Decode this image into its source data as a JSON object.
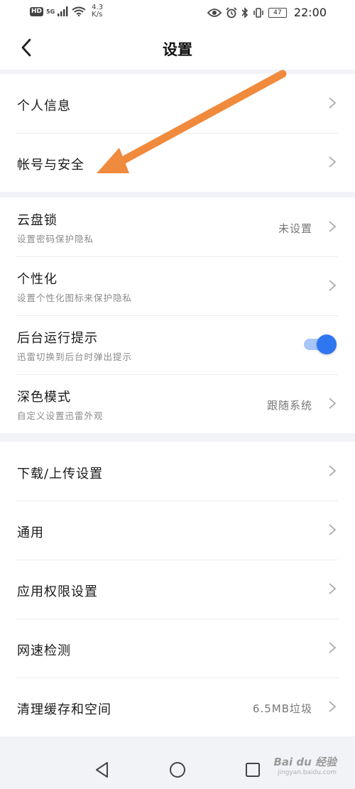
{
  "status_bar": {
    "left_badges": [
      "HD",
      "5G"
    ],
    "net_speed_value": "4.3",
    "net_speed_unit": "K/s",
    "battery": "47",
    "time": "22:00"
  },
  "navbar": {
    "title": "设置"
  },
  "groups": [
    {
      "items": [
        {
          "title": "个人信息",
          "subtitle": "",
          "value": ""
        },
        {
          "title": "帐号与安全",
          "subtitle": "",
          "value": ""
        }
      ]
    },
    {
      "items": [
        {
          "title": "云盘锁",
          "subtitle": "设置密码保护隐私",
          "value": "未设置"
        },
        {
          "title": "个性化",
          "subtitle": "设置个性化图标来保护隐私",
          "value": ""
        },
        {
          "title": "后台运行提示",
          "subtitle": "迅雷切换到后台时弹出提示",
          "toggle": true
        },
        {
          "title": "深色模式",
          "subtitle": "自定义设置迅雷外观",
          "value": "跟随系统"
        }
      ]
    },
    {
      "items": [
        {
          "title": "下载/上传设置",
          "subtitle": "",
          "value": ""
        },
        {
          "title": "通用",
          "subtitle": "",
          "value": ""
        },
        {
          "title": "应用权限设置",
          "subtitle": "",
          "value": ""
        },
        {
          "title": "网速检测",
          "subtitle": "",
          "value": ""
        },
        {
          "title": "清理缓存和空间",
          "subtitle": "",
          "value": "6.5MB垃圾"
        }
      ]
    }
  ],
  "watermark": {
    "main": "Bai du 经验",
    "sub": "jingyan.baidu.com"
  },
  "colors": {
    "accent": "#2f77f0",
    "annotation_arrow": "#f08a3c"
  }
}
